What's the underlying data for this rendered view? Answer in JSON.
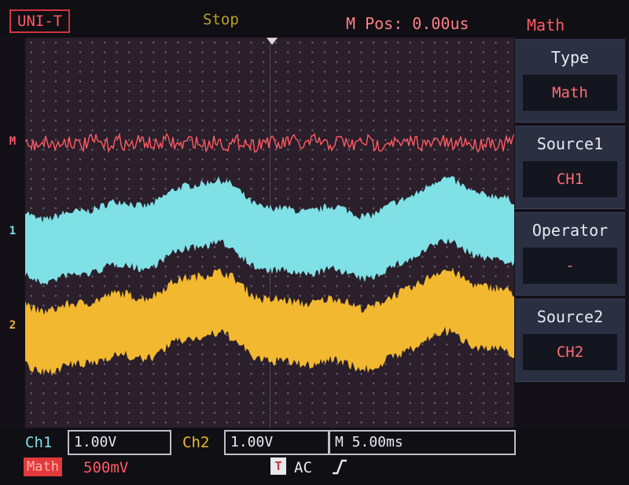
{
  "header": {
    "brand": "UNI-T",
    "run_state": "Stop",
    "m_pos": "M Pos: 0.00us",
    "menu_title": "Math"
  },
  "channel_markers": {
    "math": "M",
    "ch1": "1",
    "ch2": "2"
  },
  "side_menu": [
    {
      "label": "Type",
      "value": "Math"
    },
    {
      "label": "Source1",
      "value": "CH1"
    },
    {
      "label": "Operator",
      "value": "-"
    },
    {
      "label": "Source2",
      "value": "CH2"
    }
  ],
  "footer": {
    "ch1_label": "Ch1",
    "ch1_scale": "1.00V",
    "ch2_label": "Ch2",
    "ch2_scale": "1.00V",
    "timebase": "M 5.00ms",
    "math_label": "Math",
    "math_scale": "500mV",
    "trigger_icon_text": "T",
    "coupling": "AC"
  },
  "colors": {
    "math": "#ff5a64",
    "ch1": "#7fe0e6",
    "ch2": "#f2b830",
    "accent": "#d4343e",
    "panel": "#2a3042"
  },
  "icons": {
    "trigger": "trigger-t-icon",
    "edge": "rising-edge-icon",
    "trigger_position": "trigger-position-marker-icon"
  }
}
